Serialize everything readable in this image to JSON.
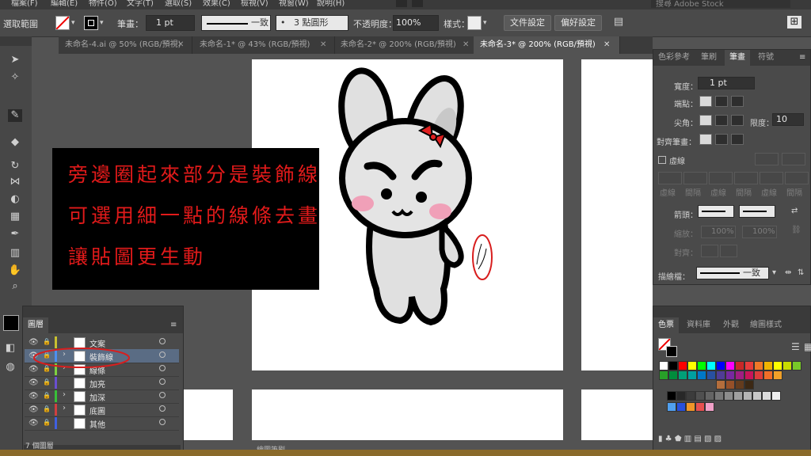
{
  "menu": [
    "檔案(F)",
    "編輯(E)",
    "物件(O)",
    "文字(T)",
    "選取(S)",
    "效果(C)",
    "檢視(V)",
    "視窗(W)",
    "說明(H)"
  ],
  "search_placeholder": "搜尋 Adobe Stock",
  "control_bar": {
    "selection_label": "選取範圍",
    "stroke_label": "筆畫：",
    "stroke_value": "1 pt",
    "profile_value": "一致",
    "brush_value": "3 點圓形",
    "opacity_label": "不透明度：",
    "opacity_value": "100%",
    "style_label": "樣式：",
    "doc_settings": "文件設定",
    "preferences": "偏好設定"
  },
  "tabs": [
    {
      "label": "未命名-4.ai @ 50% (RGB/預視)",
      "active": false
    },
    {
      "label": "未命名-1* @ 43% (RGB/預視)",
      "active": false
    },
    {
      "label": "未命名-2* @ 200% (RGB/預視)",
      "active": false
    },
    {
      "label": "未命名-3* @ 200% (RGB/預視)",
      "active": true
    }
  ],
  "annotation": {
    "line1": "旁邊圈起來部分是裝飾線",
    "line2": "可選用細一點的線條去畫",
    "line3": "讓貼圖更生動",
    "color": "#e11a1a"
  },
  "stroke_panel": {
    "tabs": [
      "色彩參考",
      "筆刷",
      "筆畫",
      "符號"
    ],
    "active_tab": "筆畫",
    "weight_label": "寬度：",
    "weight_value": "1 pt",
    "cap_label": "端點：",
    "corner_label": "尖角：",
    "limit_label": "限度：",
    "limit_value": "10",
    "align_label": "對齊筆畫：",
    "dashed_label": "虛線",
    "dash_labels": [
      "虛線",
      "間隔",
      "虛線",
      "間隔",
      "虛線",
      "間隔"
    ],
    "arrow_label": "箭頭：",
    "scale_label": "縮放：",
    "scale1": "100%",
    "scale2": "100%",
    "align2_label": "對齊：",
    "profile_label": "描繪檔：",
    "profile_value": "一致"
  },
  "layers_panel": {
    "title": "圖層",
    "layers": [
      {
        "name": "文案",
        "color": "#c8c030",
        "expand": false,
        "selected": false
      },
      {
        "name": "裝飾線",
        "color": "#4d8ff0",
        "expand": true,
        "selected": true
      },
      {
        "name": "線條",
        "color": "#7fd040",
        "expand": true,
        "selected": false
      },
      {
        "name": "加亮",
        "color": "#6a4fd0",
        "expand": false,
        "selected": false
      },
      {
        "name": "加深",
        "color": "#38c038",
        "expand": true,
        "selected": false
      },
      {
        "name": "底圖",
        "color": "#d04040",
        "expand": true,
        "selected": false
      },
      {
        "name": "其他",
        "color": "#4060e0",
        "expand": false,
        "selected": false
      }
    ],
    "count": "7 個圖層"
  },
  "swatches_panel": {
    "tabs": [
      "色票",
      "資料庫",
      "外觀",
      "繪圖樣式"
    ],
    "active_tab": "色票",
    "row1": [
      "#ffffff",
      "#000000",
      "#ff0000",
      "#ffff00",
      "#00ff00",
      "#00ffff",
      "#0000ff",
      "#ff00ff",
      "#c82828",
      "#e63c3c",
      "#f07828",
      "#f0b400",
      "#ffff00",
      "#c8dc00",
      "#78c828",
      "#28a028",
      "#008c3c",
      "#00a078",
      "#00a0a0",
      "#0078c8",
      "#2850a0",
      "#503c96",
      "#7828a0",
      "#a01e82",
      "#c8145a",
      "#dc3c3c",
      "#f06e28",
      "#f0a028"
    ],
    "row2": [
      "#b46e3c",
      "#965028",
      "#643c1e",
      "#3c2814"
    ],
    "row3": [
      "#000000",
      "#282828",
      "#3c3c3c",
      "#505050",
      "#646464",
      "#787878",
      "#8c8c8c",
      "#a0a0a0",
      "#b4b4b4",
      "#c8c8c8",
      "#dcdcdc",
      "#f0f0f0"
    ],
    "row4": [
      "#50a0f0",
      "#2850dc",
      "#f09628",
      "#e65050",
      "#f0a0c8"
    ]
  },
  "status": {
    "bottom_label": "繪圖筆刷"
  },
  "colors": {
    "panel_bg": "#4a4a4a",
    "canvas_bg": "#535353",
    "selected_layer": "#5a6c84",
    "circle_red": "#d81e1e"
  }
}
